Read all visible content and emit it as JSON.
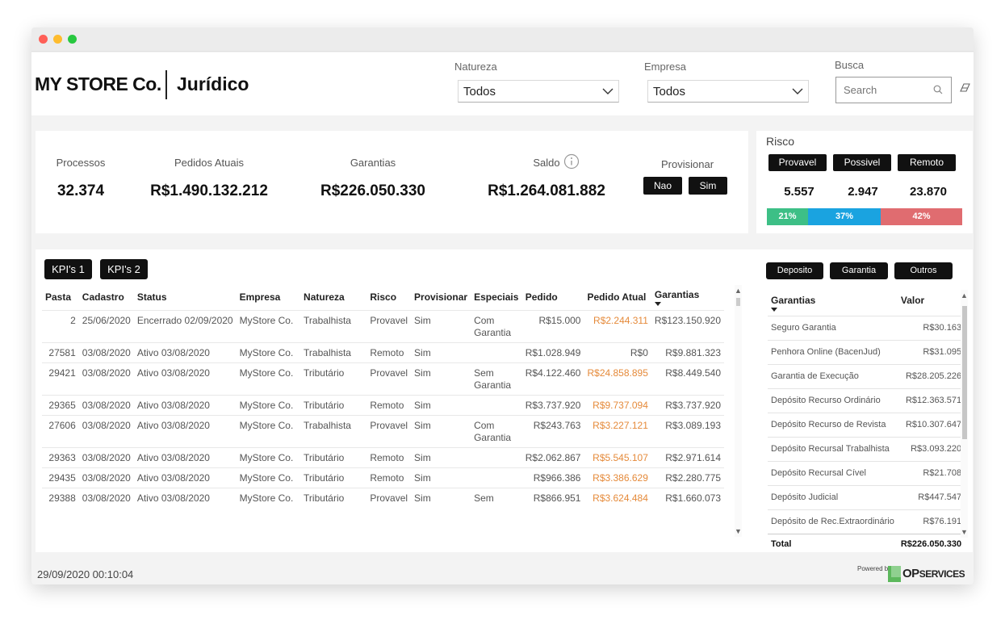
{
  "header": {
    "brand": "MY STORE Co.",
    "module": "Jurídico",
    "filters": {
      "natureza": {
        "label": "Natureza",
        "value": "Todos"
      },
      "empresa": {
        "label": "Empresa",
        "value": "Todos"
      },
      "busca": {
        "label": "Busca",
        "placeholder": "Search"
      }
    }
  },
  "kpis": {
    "processos": {
      "label": "Processos",
      "value": "32.374"
    },
    "pedidos_atuais": {
      "label": "Pedidos Atuais",
      "value": "R$1.490.132.212"
    },
    "garantias": {
      "label": "Garantias",
      "value": "R$226.050.330"
    },
    "saldo": {
      "label": "Saldo",
      "value": "R$1.264.081.882"
    },
    "provisionar": {
      "label": "Provisionar",
      "options": [
        "Nao",
        "Sim"
      ]
    }
  },
  "risco": {
    "title": "Risco",
    "buttons": [
      "Provavel",
      "Possivel",
      "Remoto"
    ],
    "values": [
      "5.557",
      "2.947",
      "23.870"
    ],
    "shares": [
      {
        "label": "21%",
        "fraction": 0.21,
        "color": "#3dbf86"
      },
      {
        "label": "37%",
        "fraction": 0.37,
        "color": "#1aa3e0"
      },
      {
        "label": "42%",
        "fraction": 0.42,
        "color": "#e06c70"
      }
    ]
  },
  "tabs": [
    "KPI's 1",
    "KPI's 2"
  ],
  "side_buttons": [
    "Deposito",
    "Garantia",
    "Outros"
  ],
  "table": {
    "columns": [
      "Pasta",
      "Cadastro",
      "Status",
      "Empresa",
      "Natureza",
      "Risco",
      "Provisionar",
      "Especiais",
      "Pedido",
      "Pedido Atual",
      "Garantias"
    ],
    "rows": [
      {
        "pasta": "2",
        "cadastro": "25/06/2020",
        "status": "Encerrado 02/09/2020",
        "empresa": "MyStore Co.",
        "natureza": "Trabalhista",
        "risco": "Provavel",
        "provisionar": "Sim",
        "especiais_1": "Com",
        "especiais_2": "Garantia",
        "pedido": "R$15.000",
        "pedido_atual": "R$2.244.311",
        "garantias": "R$123.150.920"
      },
      {
        "pasta": "27581",
        "cadastro": "03/08/2020",
        "status": "Ativo 03/08/2020",
        "empresa": "MyStore Co.",
        "natureza": "Trabalhista",
        "risco": "Remoto",
        "provisionar": "Sim",
        "especiais_1": "",
        "especiais_2": "",
        "pedido": "R$1.028.949",
        "pedido_atual": "R$0",
        "garantias": "R$9.881.323"
      },
      {
        "pasta": "29421",
        "cadastro": "03/08/2020",
        "status": "Ativo 03/08/2020",
        "empresa": "MyStore Co.",
        "natureza": "Tributário",
        "risco": "Provavel",
        "provisionar": "Sim",
        "especiais_1": "Sem",
        "especiais_2": "Garantia",
        "pedido": "R$4.122.460",
        "pedido_atual": "R$24.858.895",
        "garantias": "R$8.449.540"
      },
      {
        "pasta": "29365",
        "cadastro": "03/08/2020",
        "status": "Ativo 03/08/2020",
        "empresa": "MyStore Co.",
        "natureza": "Tributário",
        "risco": "Remoto",
        "provisionar": "Sim",
        "especiais_1": "",
        "especiais_2": "",
        "pedido": "R$3.737.920",
        "pedido_atual": "R$9.737.094",
        "garantias": "R$3.737.920"
      },
      {
        "pasta": "27606",
        "cadastro": "03/08/2020",
        "status": "Ativo 03/08/2020",
        "empresa": "MyStore Co.",
        "natureza": "Trabalhista",
        "risco": "Provavel",
        "provisionar": "Sim",
        "especiais_1": "Com",
        "especiais_2": "Garantia",
        "pedido": "R$243.763",
        "pedido_atual": "R$3.227.121",
        "garantias": "R$3.089.193"
      },
      {
        "pasta": "29363",
        "cadastro": "03/08/2020",
        "status": "Ativo 03/08/2020",
        "empresa": "MyStore Co.",
        "natureza": "Tributário",
        "risco": "Remoto",
        "provisionar": "Sim",
        "especiais_1": "",
        "especiais_2": "",
        "pedido": "R$2.062.867",
        "pedido_atual": "R$5.545.107",
        "garantias": "R$2.971.614"
      },
      {
        "pasta": "29435",
        "cadastro": "03/08/2020",
        "status": "Ativo 03/08/2020",
        "empresa": "MyStore Co.",
        "natureza": "Tributário",
        "risco": "Remoto",
        "provisionar": "Sim",
        "especiais_1": "",
        "especiais_2": "",
        "pedido": "R$966.386",
        "pedido_atual": "R$3.386.629",
        "garantias": "R$2.280.775"
      },
      {
        "pasta": "29388",
        "cadastro": "03/08/2020",
        "status": "Ativo 03/08/2020",
        "empresa": "MyStore Co.",
        "natureza": "Tributário",
        "risco": "Provavel",
        "provisionar": "Sim",
        "especiais_1": "Sem",
        "especiais_2": "",
        "pedido": "R$866.951",
        "pedido_atual": "R$3.624.484",
        "garantias": "R$1.660.073"
      }
    ]
  },
  "garantias_table": {
    "columns": [
      "Garantias",
      "Valor"
    ],
    "rows": [
      {
        "name": "Seguro Garantia",
        "value": "R$30.163"
      },
      {
        "name": "Penhora Online (BacenJud)",
        "value": "R$31.095"
      },
      {
        "name": "Garantia de Execução",
        "value": "R$28.205.226"
      },
      {
        "name": "Depósito Recurso Ordinário",
        "value": "R$12.363.571"
      },
      {
        "name": "Depósito Recurso de Revista",
        "value": "R$10.307.647"
      },
      {
        "name": "Depósito Recursal Trabalhista",
        "value": "R$3.093.220"
      },
      {
        "name": "Depósito Recursal Cível",
        "value": "R$21.708"
      },
      {
        "name": "Depósito Judicial",
        "value": "R$447.547"
      },
      {
        "name": "Depósito de Rec.Extraordinário",
        "value": "R$76.191"
      }
    ],
    "total_label": "Total",
    "total_value": "R$226.050.330"
  },
  "footer": {
    "timestamp": "29/09/2020 00:10:04",
    "powered_by": "Powered by",
    "logo_op": "OP",
    "logo_services": "SERVICES"
  },
  "colors": {
    "accent_orange": "#e58a3a",
    "button_black": "#111111"
  },
  "icons": [
    "chevron-down-icon",
    "search-icon",
    "eraser-icon",
    "info-icon",
    "sort-down-icon",
    "scroll-up-icon",
    "scroll-down-icon"
  ]
}
